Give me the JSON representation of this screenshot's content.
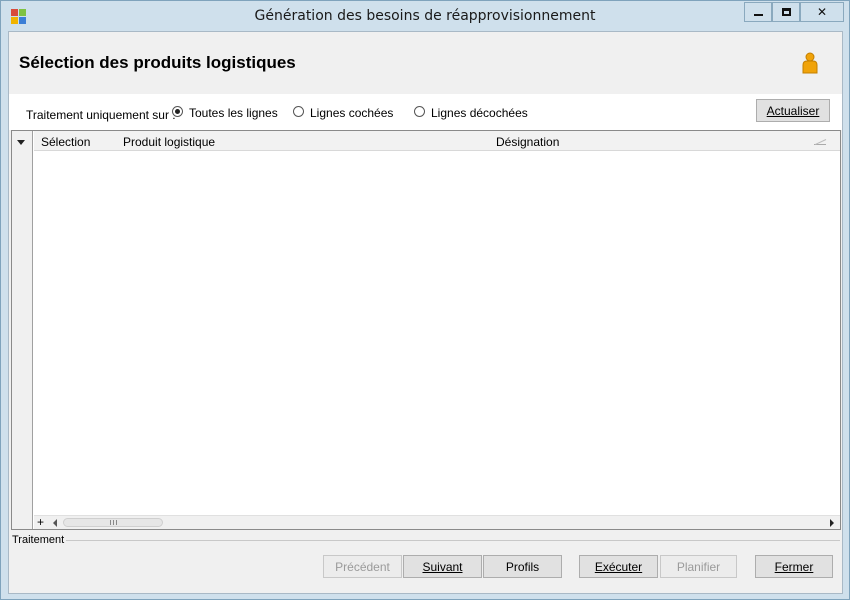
{
  "window": {
    "title": "Génération des besoins de réapprovisionnement",
    "controls": {
      "minimize": "▁",
      "maximize": "◻",
      "close": "✕"
    },
    "icon_colors": [
      "#d94b3a",
      "#7fc242",
      "#3c7fd6",
      "#f0b400"
    ]
  },
  "header": {
    "title": "Sélection des produits logistiques",
    "icon": "user-icon"
  },
  "filter": {
    "label": "Traitement uniquement sur :",
    "options": [
      {
        "label": "Toutes les lignes",
        "checked": true
      },
      {
        "label": "Lignes cochées",
        "checked": false
      },
      {
        "label": "Lignes décochées",
        "checked": false
      }
    ],
    "refresh_label": "Actualiser"
  },
  "grid": {
    "columns": [
      "Sélection",
      "Produit logistique",
      "Désignation"
    ],
    "rows": [],
    "add_row_symbol": "+"
  },
  "status": {
    "label": "Traitement"
  },
  "footer": {
    "previous_label": "Précédent",
    "next_label": "Suivant",
    "profiles_label": "Profils",
    "execute_label": "Exécuter",
    "schedule_label": "Planifier",
    "close_label": "Fermer"
  },
  "colors": {
    "titlebar": "#cfe0ec",
    "client": "#f0f0f0",
    "user_icon": "#f0a30a"
  }
}
